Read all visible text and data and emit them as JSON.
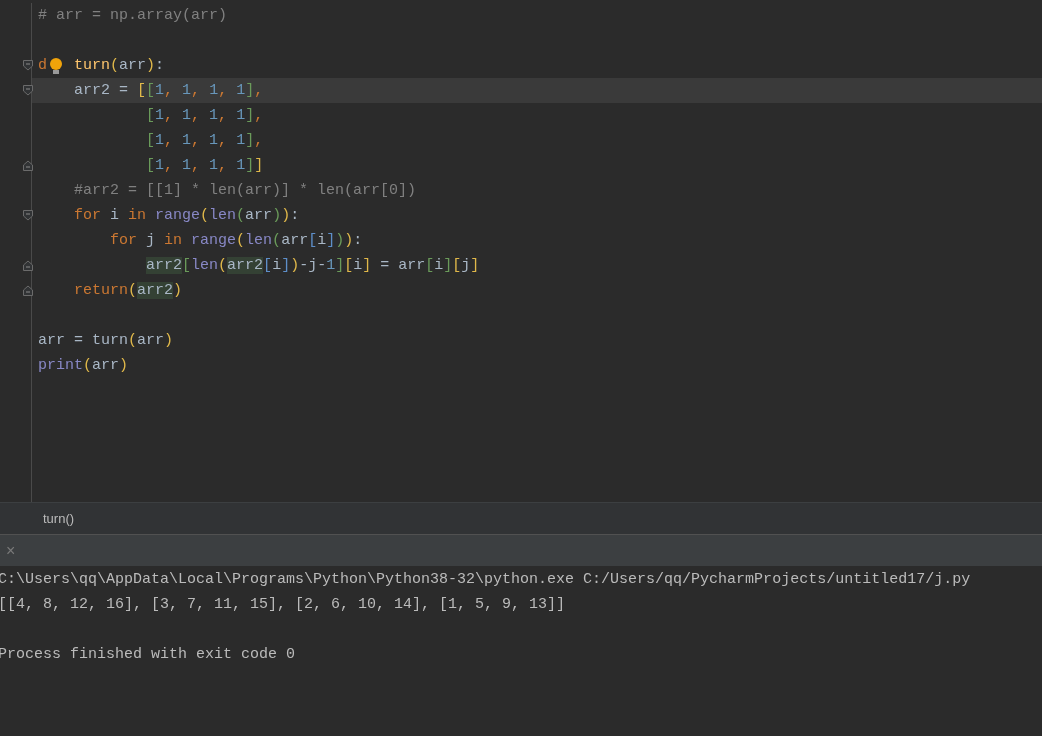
{
  "editor": {
    "lines": [
      {
        "fold_start": false,
        "fold_end": false,
        "current": false,
        "tokens": [
          {
            "kind": "c",
            "text": "# arr = np.array(arr)"
          }
        ]
      },
      {
        "fold_start": false,
        "fold_end": false,
        "current": false
      },
      {
        "fold_start": true,
        "fold_end": false,
        "current": false,
        "tokens": [
          {
            "kind": "k",
            "text": "d"
          },
          {
            "kind": "bulb"
          },
          {
            "kind": "f",
            "text": " turn"
          },
          {
            "kind": "y",
            "text": "("
          },
          {
            "kind": "t",
            "text": "arr"
          },
          {
            "kind": "y",
            "text": ")"
          },
          {
            "kind": "t",
            "text": ":"
          }
        ]
      },
      {
        "fold_start": true,
        "fold_end": false,
        "current": true,
        "tokens": [
          {
            "kind": "t",
            "text": "    arr2 = "
          },
          {
            "kind": "y",
            "text": "["
          },
          {
            "kind": "g",
            "text": "["
          },
          {
            "kind": "n",
            "text": "1"
          },
          {
            "kind": "k",
            "text": ", "
          },
          {
            "kind": "n",
            "text": "1"
          },
          {
            "kind": "k",
            "text": ", "
          },
          {
            "kind": "n",
            "text": "1"
          },
          {
            "kind": "k",
            "text": ", "
          },
          {
            "kind": "n",
            "text": "1"
          },
          {
            "kind": "g",
            "text": "]"
          },
          {
            "kind": "k",
            "text": ","
          }
        ]
      },
      {
        "fold_start": false,
        "fold_end": false,
        "current": false,
        "tokens": [
          {
            "kind": "g",
            "text": "            ["
          },
          {
            "kind": "n",
            "text": "1"
          },
          {
            "kind": "k",
            "text": ", "
          },
          {
            "kind": "n",
            "text": "1"
          },
          {
            "kind": "k",
            "text": ", "
          },
          {
            "kind": "n",
            "text": "1"
          },
          {
            "kind": "k",
            "text": ", "
          },
          {
            "kind": "n",
            "text": "1"
          },
          {
            "kind": "g",
            "text": "]"
          },
          {
            "kind": "k",
            "text": ","
          }
        ]
      },
      {
        "fold_start": false,
        "fold_end": false,
        "current": false,
        "tokens": [
          {
            "kind": "g",
            "text": "            ["
          },
          {
            "kind": "n",
            "text": "1"
          },
          {
            "kind": "k",
            "text": ", "
          },
          {
            "kind": "n",
            "text": "1"
          },
          {
            "kind": "k",
            "text": ", "
          },
          {
            "kind": "n",
            "text": "1"
          },
          {
            "kind": "k",
            "text": ", "
          },
          {
            "kind": "n",
            "text": "1"
          },
          {
            "kind": "g",
            "text": "]"
          },
          {
            "kind": "k",
            "text": ","
          }
        ]
      },
      {
        "fold_start": false,
        "fold_end": true,
        "current": false,
        "tokens": [
          {
            "kind": "g",
            "text": "            ["
          },
          {
            "kind": "n",
            "text": "1"
          },
          {
            "kind": "k",
            "text": ", "
          },
          {
            "kind": "n",
            "text": "1"
          },
          {
            "kind": "k",
            "text": ", "
          },
          {
            "kind": "n",
            "text": "1"
          },
          {
            "kind": "k",
            "text": ", "
          },
          {
            "kind": "n",
            "text": "1"
          },
          {
            "kind": "g",
            "text": "]"
          },
          {
            "kind": "y",
            "text": "]"
          }
        ]
      },
      {
        "fold_start": false,
        "fold_end": false,
        "current": false,
        "tokens": [
          {
            "kind": "c",
            "text": "    #arr2 = [[1] * len(arr)] * len(arr[0])"
          }
        ]
      },
      {
        "fold_start": true,
        "fold_end": false,
        "current": false,
        "tokens": [
          {
            "kind": "k",
            "text": "    for "
          },
          {
            "kind": "t",
            "text": "i "
          },
          {
            "kind": "k",
            "text": "in "
          },
          {
            "kind": "b",
            "text": "range"
          },
          {
            "kind": "y",
            "text": "("
          },
          {
            "kind": "b",
            "text": "len"
          },
          {
            "kind": "g",
            "text": "("
          },
          {
            "kind": "t",
            "text": "arr"
          },
          {
            "kind": "g",
            "text": ")"
          },
          {
            "kind": "y",
            "text": ")"
          },
          {
            "kind": "t",
            "text": ":"
          }
        ]
      },
      {
        "fold_start": false,
        "fold_end": false,
        "current": false,
        "tokens": [
          {
            "kind": "k",
            "text": "        for "
          },
          {
            "kind": "t",
            "text": "j "
          },
          {
            "kind": "k",
            "text": "in "
          },
          {
            "kind": "b",
            "text": "range"
          },
          {
            "kind": "y",
            "text": "("
          },
          {
            "kind": "b",
            "text": "len"
          },
          {
            "kind": "g",
            "text": "("
          },
          {
            "kind": "t",
            "text": "arr"
          },
          {
            "kind": "u",
            "text": "["
          },
          {
            "kind": "t",
            "text": "i"
          },
          {
            "kind": "u",
            "text": "]"
          },
          {
            "kind": "g",
            "text": ")"
          },
          {
            "kind": "y",
            "text": ")"
          },
          {
            "kind": "t",
            "text": ":"
          }
        ]
      },
      {
        "fold_start": false,
        "fold_end": true,
        "current": false,
        "tokens": [
          {
            "kind": "h",
            "text": "            arr2"
          },
          {
            "kind": "g",
            "text": "["
          },
          {
            "kind": "b",
            "text": "len"
          },
          {
            "kind": "y",
            "text": "("
          },
          {
            "kind": "h",
            "text": "arr2"
          },
          {
            "kind": "u",
            "text": "["
          },
          {
            "kind": "t",
            "text": "i"
          },
          {
            "kind": "u",
            "text": "]"
          },
          {
            "kind": "y",
            "text": ")"
          },
          {
            "kind": "t",
            "text": "-j-"
          },
          {
            "kind": "n",
            "text": "1"
          },
          {
            "kind": "g",
            "text": "]"
          },
          {
            "kind": "y",
            "text": "["
          },
          {
            "kind": "t",
            "text": "i"
          },
          {
            "kind": "y",
            "text": "]"
          },
          {
            "kind": "t",
            "text": " = arr"
          },
          {
            "kind": "g",
            "text": "["
          },
          {
            "kind": "t",
            "text": "i"
          },
          {
            "kind": "g",
            "text": "]"
          },
          {
            "kind": "y",
            "text": "["
          },
          {
            "kind": "t",
            "text": "j"
          },
          {
            "kind": "y",
            "text": "]"
          }
        ]
      },
      {
        "fold_start": false,
        "fold_end": true,
        "current": false,
        "tokens": [
          {
            "kind": "k",
            "text": "    return"
          },
          {
            "kind": "y",
            "text": "("
          },
          {
            "kind": "h",
            "text": "arr2"
          },
          {
            "kind": "y",
            "text": ")"
          }
        ]
      },
      {
        "fold_start": false,
        "fold_end": false,
        "current": false
      },
      {
        "fold_start": false,
        "fold_end": false,
        "current": false,
        "tokens": [
          {
            "kind": "t",
            "text": "arr = turn"
          },
          {
            "kind": "y",
            "text": "("
          },
          {
            "kind": "t",
            "text": "arr"
          },
          {
            "kind": "y",
            "text": ")"
          }
        ]
      },
      {
        "fold_start": false,
        "fold_end": false,
        "current": false,
        "tokens": [
          {
            "kind": "b",
            "text": "print"
          },
          {
            "kind": "y",
            "text": "("
          },
          {
            "kind": "t",
            "text": "arr"
          },
          {
            "kind": "y",
            "text": ")"
          }
        ]
      }
    ]
  },
  "breadcrumb": "turn()",
  "run_panel": {
    "close": "×",
    "output": [
      {
        "text": "C:\\Users\\qq\\AppData\\Local\\Programs\\Python\\Python38-32\\python.exe C:/Users/qq/PycharmProjects/untitled17/j.py",
        "gap_before": false
      },
      {
        "text": "[[4, 8, 12, 16], [3, 7, 11, 15], [2, 6, 10, 14], [1, 5, 9, 13]]",
        "gap_before": false
      },
      {
        "text": "Process finished with exit code 0",
        "gap_before": true
      }
    ]
  }
}
